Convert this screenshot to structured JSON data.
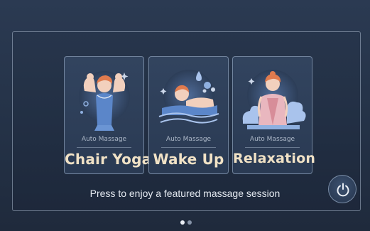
{
  "cards": [
    {
      "category": "Auto Massage",
      "title": "Chair Yoga",
      "icon": "arms-flex-icon"
    },
    {
      "category": "Auto Massage",
      "title": "Wake Up",
      "icon": "lying-woman-icon"
    },
    {
      "category": "Auto Massage",
      "title": "Relaxation",
      "icon": "calm-woman-icon"
    }
  ],
  "prompt": "Press to enjoy a featured massage session",
  "power_button": {
    "icon": "power-icon"
  },
  "pager": {
    "current": 1,
    "total": 2
  },
  "colors": {
    "background": "#243247",
    "card": "#2f4059",
    "title_text": "#f1e2c6",
    "accent_orange": "#e07b4e",
    "accent_blue": "#5b86c9"
  }
}
